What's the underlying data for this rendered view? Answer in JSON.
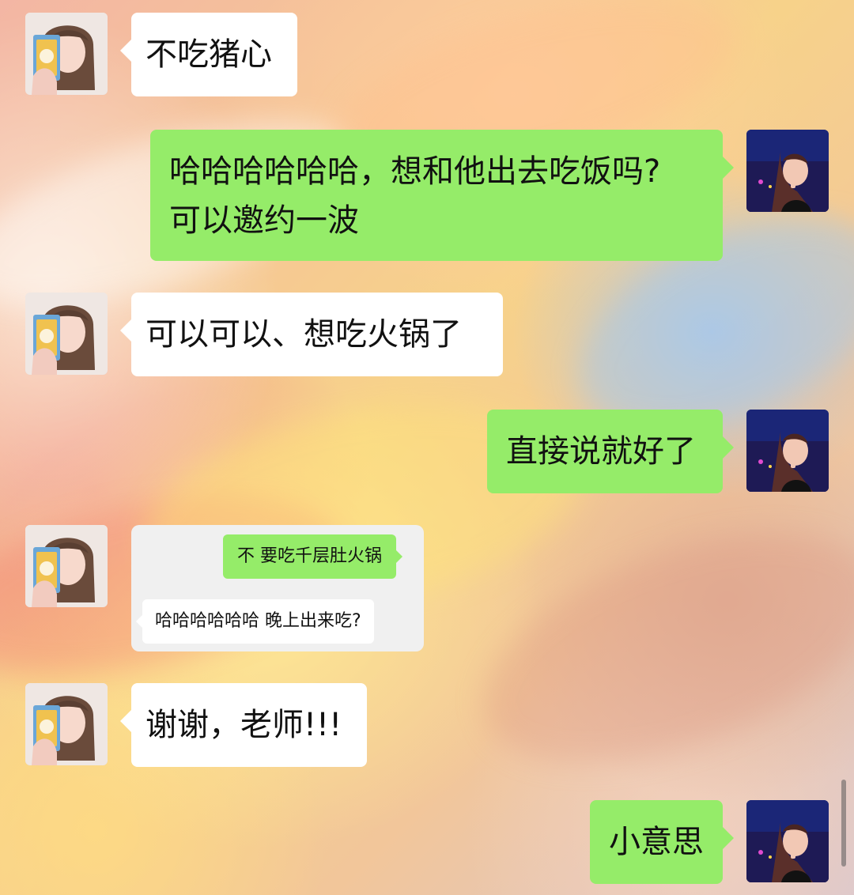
{
  "chat": {
    "messages": [
      {
        "side": "left",
        "text": "不吃猪心"
      },
      {
        "side": "right",
        "line1": "哈哈哈哈哈哈，想和他出去吃饭吗?",
        "line2": "可以邀约一波"
      },
      {
        "side": "left",
        "text": "可以可以、想吃火锅了"
      },
      {
        "side": "right",
        "text": "直接说就好了"
      },
      {
        "side": "left",
        "embedded": {
          "green_text": "不 要吃千层肚火锅",
          "white_text": "哈哈哈哈哈哈 晚上出来吃?"
        }
      },
      {
        "side": "left",
        "text": "谢谢，老师!!!"
      },
      {
        "side": "right",
        "text": "小意思"
      }
    ]
  },
  "colors": {
    "incoming_bubble": "#ffffff",
    "outgoing_bubble": "#95ec69",
    "text": "#111111"
  },
  "icons": {
    "left_avatar": "girl-avatar",
    "right_avatar": "woman-avatar"
  }
}
